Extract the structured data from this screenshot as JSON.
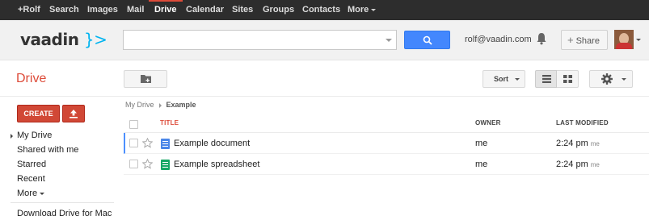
{
  "topbar": {
    "items": [
      {
        "label": "+Rolf"
      },
      {
        "label": "Search"
      },
      {
        "label": "Images"
      },
      {
        "label": "Mail"
      },
      {
        "label": "Drive"
      },
      {
        "label": "Calendar"
      },
      {
        "label": "Sites"
      },
      {
        "label": "Groups"
      },
      {
        "label": "Contacts"
      },
      {
        "label": "More"
      }
    ],
    "active": "Drive"
  },
  "header": {
    "logo_text": "vaadin",
    "logo_bracket": "}>",
    "search": {
      "value": "",
      "placeholder": ""
    },
    "user_email": "rolf@vaadin.com",
    "share_label": "Share"
  },
  "appbar": {
    "title": "Drive",
    "sort_label": "Sort"
  },
  "sidebar": {
    "create_label": "CREATE",
    "items": [
      {
        "label": "My Drive"
      },
      {
        "label": "Shared with me"
      },
      {
        "label": "Starred"
      },
      {
        "label": "Recent"
      },
      {
        "label": "More"
      }
    ],
    "download_label": "Download Drive for Mac"
  },
  "breadcrumb": {
    "root": "My Drive",
    "current": "Example"
  },
  "table": {
    "headers": {
      "title": "TITLE",
      "owner": "OWNER",
      "modified": "LAST MODIFIED"
    },
    "rows": [
      {
        "type": "doc-icon",
        "name": "Example document",
        "owner": "me",
        "time": "2:24 pm",
        "by": "me"
      },
      {
        "type": "sheet-icon",
        "name": "Example spreadsheet",
        "owner": "me",
        "time": "2:24 pm",
        "by": "me"
      }
    ]
  },
  "colors": {
    "accent_red": "#dd4b39",
    "create_red": "#d14836",
    "search_blue": "#4387fd",
    "logo_blue": "#00b4f0",
    "doc_blue": "#4a86e8",
    "sheet_green": "#16a765"
  }
}
